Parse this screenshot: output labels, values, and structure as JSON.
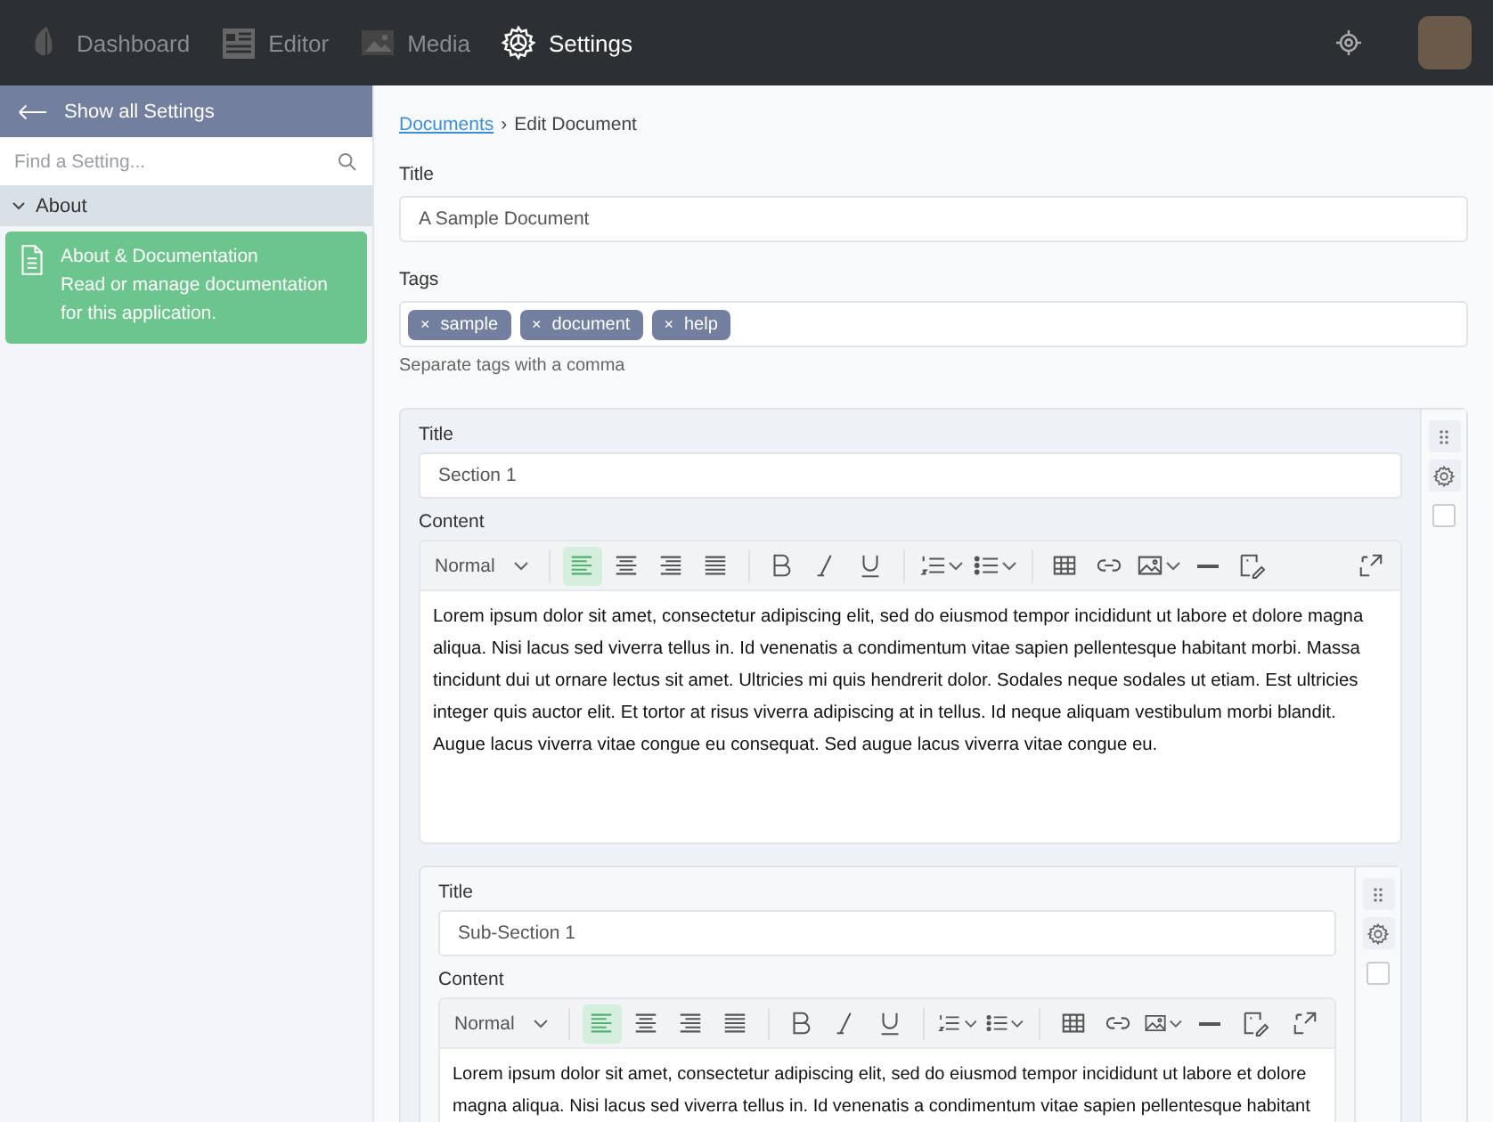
{
  "topbar": {
    "nav": [
      {
        "label": "Dashboard",
        "kind": "leaf",
        "selected": false
      },
      {
        "label": "Editor",
        "kind": "newspaper",
        "selected": false
      },
      {
        "label": "Media",
        "kind": "image",
        "selected": false
      },
      {
        "label": "Settings",
        "kind": "gear",
        "selected": true
      }
    ]
  },
  "sidebar": {
    "back_link": "Show all Settings",
    "search": {
      "placeholder": "Find a Setting..."
    },
    "groups": [
      {
        "label": "About",
        "expanded": true,
        "items": [
          {
            "title": "About & Documentation",
            "description": "Read or manage documentation for this application.",
            "selected": true
          }
        ]
      }
    ]
  },
  "breadcrumb": {
    "link": "Documents",
    "separator": "›",
    "current": "Edit Document"
  },
  "form": {
    "title_label": "Title",
    "title_value": "A Sample Document",
    "tags_label": "Tags",
    "tags": [
      {
        "remove": "×",
        "label": "sample"
      },
      {
        "remove": "×",
        "label": "document"
      },
      {
        "remove": "×",
        "label": "help"
      }
    ],
    "tags_hint": "Separate tags with a comma"
  },
  "sections": [
    {
      "title_label": "Title",
      "title_value": "Section 1",
      "content_label": "Content",
      "checked": false,
      "toolbar": [
        {
          "kind": "select",
          "label": "Normal"
        },
        {
          "kind": "divider"
        },
        {
          "kind": "align-left",
          "selected": true
        },
        {
          "kind": "align-center",
          "selected": false
        },
        {
          "kind": "align-right",
          "selected": false
        },
        {
          "kind": "justify",
          "selected": false
        },
        {
          "kind": "divider"
        },
        {
          "kind": "bold"
        },
        {
          "kind": "italic"
        },
        {
          "kind": "underline"
        },
        {
          "kind": "divider"
        },
        {
          "kind": "ordered-list"
        },
        {
          "kind": "bullet-list"
        },
        {
          "kind": "divider"
        },
        {
          "kind": "table"
        },
        {
          "kind": "link"
        },
        {
          "kind": "image"
        },
        {
          "kind": "rule"
        },
        {
          "kind": "clear-format"
        },
        {
          "kind": "spacer"
        },
        {
          "kind": "fullscreen"
        }
      ],
      "content": "Lorem ipsum dolor sit amet, consectetur adipiscing elit, sed do eiusmod tempor incididunt ut labore et dolore magna aliqua. Nisi lacus sed viverra tellus in. Id venenatis a condimentum vitae sapien pellentesque habitant morbi. Massa tincidunt dui ut ornare lectus sit amet. Ultricies mi quis hendrerit dolor. Sodales neque sodales ut etiam. Est ultricies integer quis auctor elit. Et tortor at risus viverra adipiscing at in tellus. Id neque aliquam vestibulum morbi blandit. Augue lacus viverra vitae congue eu consequat. Sed augue lacus viverra vitae congue eu.",
      "children": [
        {
          "title_label": "Title",
          "title_value": "Sub-Section 1",
          "content_label": "Content",
          "checked": false,
          "toolbar": [
            {
              "kind": "select",
              "label": "Normal"
            },
            {
              "kind": "divider"
            },
            {
              "kind": "align-left",
              "selected": true
            },
            {
              "kind": "align-center",
              "selected": false
            },
            {
              "kind": "align-right",
              "selected": false
            },
            {
              "kind": "justify",
              "selected": false
            },
            {
              "kind": "divider"
            },
            {
              "kind": "bold"
            },
            {
              "kind": "italic"
            },
            {
              "kind": "underline"
            },
            {
              "kind": "divider"
            },
            {
              "kind": "ordered-list"
            },
            {
              "kind": "bullet-list"
            },
            {
              "kind": "divider"
            },
            {
              "kind": "table"
            },
            {
              "kind": "link"
            },
            {
              "kind": "image"
            },
            {
              "kind": "rule"
            },
            {
              "kind": "clear-format"
            },
            {
              "kind": "spacer"
            },
            {
              "kind": "fullscreen"
            }
          ],
          "content": "Lorem ipsum dolor sit amet, consectetur adipiscing elit, sed do eiusmod tempor incididunt ut labore et dolore magna aliqua. Nisi lacus sed viverra tellus in. Id venenatis a condimentum vitae sapien pellentesque habitant"
        }
      ]
    }
  ]
}
